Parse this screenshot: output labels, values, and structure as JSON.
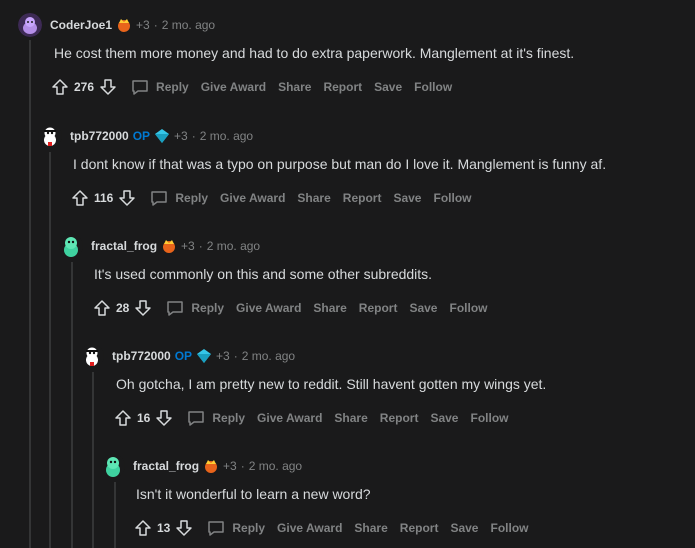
{
  "comments": [
    {
      "username": "CoderJoe1",
      "op": "",
      "karma": "+3",
      "separator": "·",
      "time": "2 mo. ago",
      "text": "He cost them more money and had to do extra paperwork. Manglement at it's finest.",
      "score": "276",
      "avatar_icon": "purple-snoo-avatar",
      "flair_icon": "crown-award-icon"
    },
    {
      "username": "tpb772000",
      "op": "OP",
      "karma": "+3",
      "separator": "·",
      "time": "2 mo. ago",
      "text": "I dont know if that was a typo on purpose but man do I love it. Manglement is funny af.",
      "score": "116",
      "avatar_icon": "white-snoo-avatar",
      "flair_icon": "diamond-award-icon"
    },
    {
      "username": "fractal_frog",
      "op": "",
      "karma": "+3",
      "separator": "·",
      "time": "2 mo. ago",
      "text": "It's used commonly on this and some other subreddits.",
      "score": "28",
      "avatar_icon": "green-snoo-avatar",
      "flair_icon": "crown-award-icon"
    },
    {
      "username": "tpb772000",
      "op": "OP",
      "karma": "+3",
      "separator": "·",
      "time": "2 mo. ago",
      "text": "Oh gotcha, I am pretty new to reddit. Still havent gotten my wings yet.",
      "score": "16",
      "avatar_icon": "white-snoo-avatar",
      "flair_icon": "diamond-award-icon"
    },
    {
      "username": "fractal_frog",
      "op": "",
      "karma": "+3",
      "separator": "·",
      "time": "2 mo. ago",
      "text": "Isn't it wonderful to learn a new word?",
      "score": "13",
      "avatar_icon": "green-snoo-avatar",
      "flair_icon": "crown-award-icon"
    }
  ],
  "actions": {
    "reply": "Reply",
    "give_award": "Give Award",
    "share": "Share",
    "report": "Report",
    "save": "Save",
    "follow": "Follow"
  },
  "colors": {
    "background": "#1a1a1b",
    "text": "#d7dadc",
    "muted": "#818384",
    "op_blue": "#0079d3"
  }
}
